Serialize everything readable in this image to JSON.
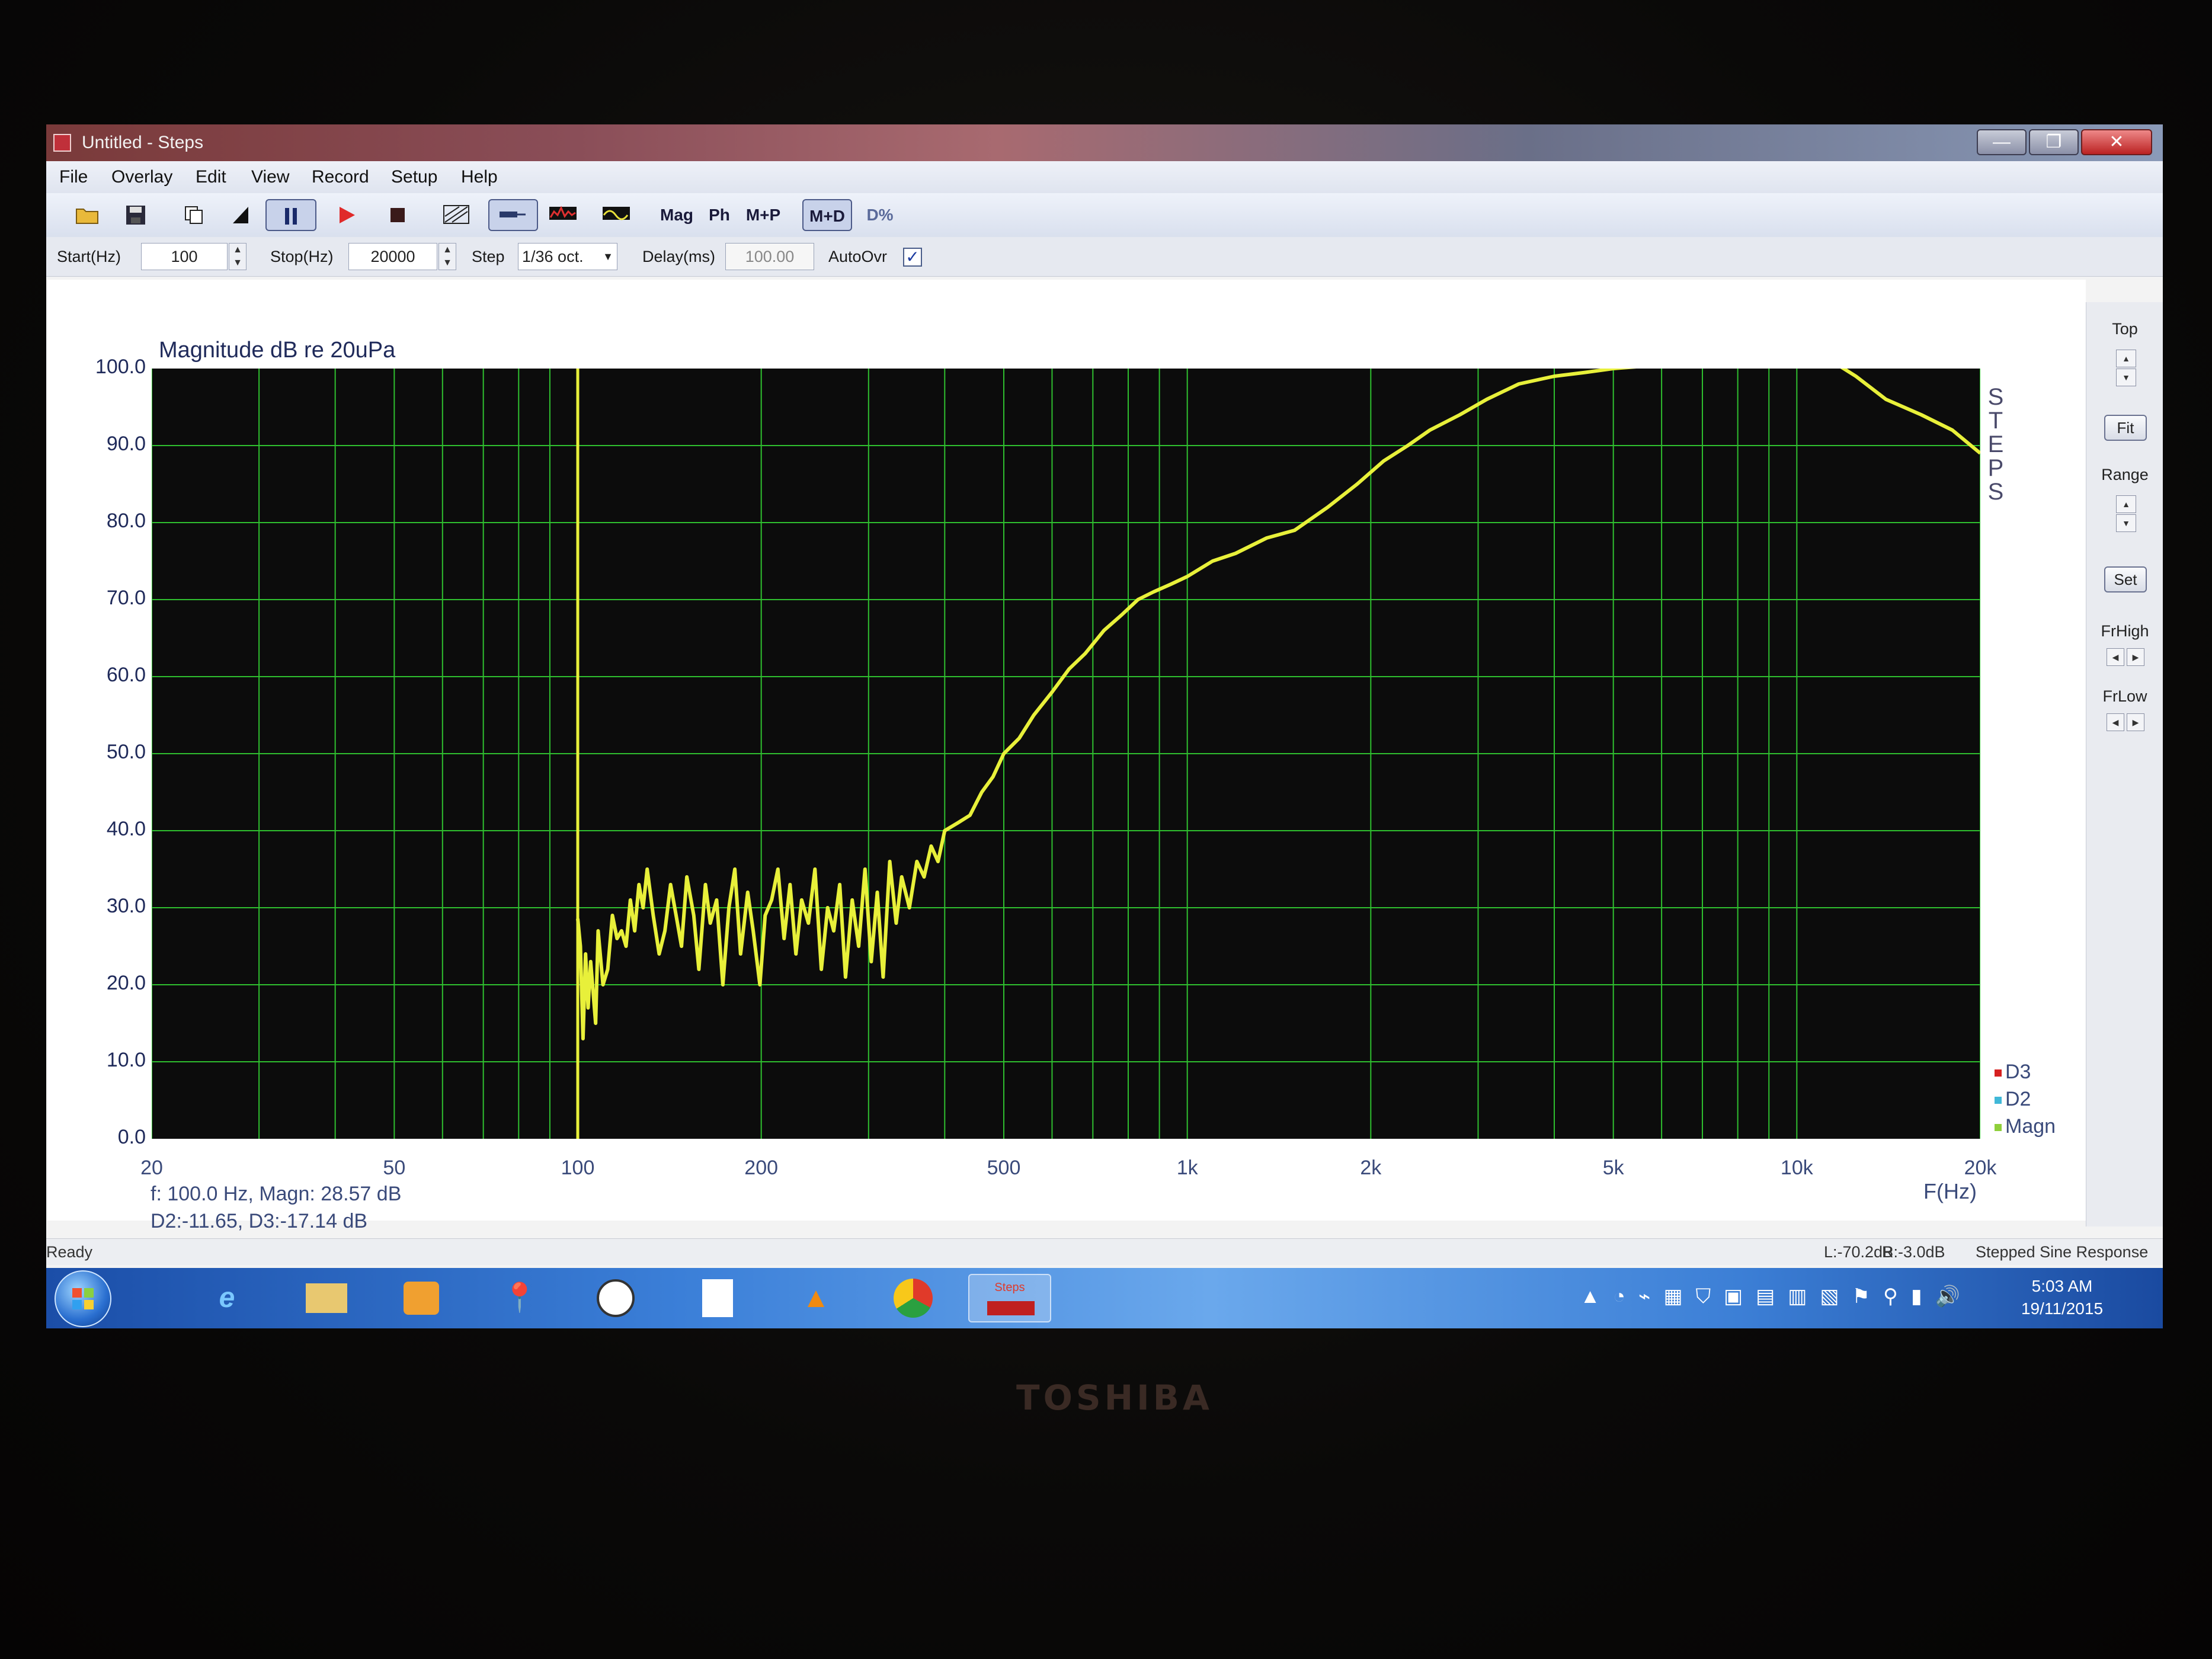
{
  "window": {
    "title": "Untitled - Steps",
    "controls": {
      "minimize": "—",
      "maximize": "❐",
      "close": "✕"
    }
  },
  "menu": [
    "File",
    "Overlay",
    "Edit",
    "View",
    "Record",
    "Setup",
    "Help"
  ],
  "toolbar": {
    "mag": "Mag",
    "ph": "Ph",
    "mp": "M+P",
    "md": "M+D",
    "dpct": "D%"
  },
  "params": {
    "start_label": "Start(Hz)",
    "start_value": "100",
    "stop_label": "Stop(Hz)",
    "stop_value": "20000",
    "step_label": "Step",
    "step_value": "1/36 oct.",
    "delay_label": "Delay(ms)",
    "delay_value": "100.00",
    "autoovr_label": "AutoOvr",
    "autoovr_checked": "✓"
  },
  "right_panel": {
    "top": "Top",
    "fit": "Fit",
    "range": "Range",
    "set": "Set",
    "frhigh": "FrHigh",
    "frlow": "FrLow"
  },
  "readout": {
    "line1": "f:  100.0 Hz, Magn: 28.57 dB",
    "line2": "D2:-11.65, D3:-17.14 dB"
  },
  "status": {
    "left": "Ready",
    "l": "L:-70.2dB",
    "r": "R:-3.0dB",
    "mode": "Stepped Sine Response"
  },
  "taskbar": {
    "time": "5:03 AM",
    "date": "19/11/2015",
    "steps_label": "Steps"
  },
  "brand": "TOSHIBA",
  "chart_data": {
    "type": "line",
    "title": "Magnitude dB re 20uPa",
    "ylabel": "Magnitude dB re 20uPa",
    "xlabel": "F(Hz)",
    "x_scale": "log",
    "xlim": [
      20,
      20000
    ],
    "ylim": [
      0,
      100
    ],
    "yticks": [
      "0.0",
      "10.0",
      "20.0",
      "30.0",
      "40.0",
      "50.0",
      "60.0",
      "70.0",
      "80.0",
      "90.0",
      "100.0"
    ],
    "xticks": [
      {
        "v": 20,
        "label": "20"
      },
      {
        "v": 50,
        "label": "50"
      },
      {
        "v": 100,
        "label": "100"
      },
      {
        "v": 200,
        "label": "200"
      },
      {
        "v": 500,
        "label": "500"
      },
      {
        "v": 1000,
        "label": "1k"
      },
      {
        "v": 2000,
        "label": "2k"
      },
      {
        "v": 5000,
        "label": "5k"
      },
      {
        "v": 10000,
        "label": "10k"
      },
      {
        "v": 20000,
        "label": "20k"
      }
    ],
    "grid": true,
    "side_label": "STEPS",
    "legend": [
      {
        "name": "D3",
        "color": "#d62020"
      },
      {
        "name": "D2",
        "color": "#40b8d8"
      },
      {
        "name": "Magn",
        "color": "#8fcf3a"
      }
    ],
    "cursor_x": 100,
    "colors": {
      "background": "#0c0c0c",
      "grid": "#2fbf2f",
      "trace": "#e8f03a",
      "cursor": "#e8f03a"
    },
    "series": [
      {
        "name": "Magn",
        "x": [
          100,
          101,
          102,
          103,
          104,
          105,
          107,
          108,
          110,
          112,
          114,
          116,
          118,
          120,
          122,
          124,
          126,
          128,
          130,
          133,
          136,
          139,
          142,
          145,
          148,
          151,
          155,
          158,
          162,
          165,
          169,
          173,
          177,
          181,
          185,
          190,
          194,
          199,
          203,
          208,
          213,
          218,
          223,
          228,
          233,
          239,
          245,
          251,
          257,
          263,
          269,
          275,
          282,
          289,
          296,
          303,
          310,
          317,
          325,
          333,
          340,
          350,
          360,
          370,
          380,
          390,
          400,
          420,
          440,
          460,
          480,
          500,
          530,
          560,
          600,
          640,
          680,
          730,
          780,
          830,
          880,
          940,
          1000,
          1100,
          1200,
          1350,
          1500,
          1700,
          1900,
          2100,
          2300,
          2500,
          2800,
          3100,
          3500,
          4000,
          4500,
          5000,
          5600,
          6300,
          7000,
          8000,
          9000,
          10000,
          10700,
          11500,
          12500,
          14000,
          16000,
          18000,
          20000
        ],
        "y": [
          28.57,
          25,
          13,
          24,
          17,
          23,
          15,
          27,
          20,
          22,
          29,
          26,
          27,
          25,
          31,
          27,
          33,
          30,
          35,
          29,
          24,
          27,
          33,
          29,
          25,
          34,
          29,
          22,
          33,
          28,
          31,
          20,
          30,
          35,
          24,
          32,
          27,
          20,
          29,
          31,
          35,
          26,
          33,
          24,
          31,
          28,
          35,
          22,
          30,
          27,
          33,
          21,
          31,
          25,
          35,
          23,
          32,
          21,
          36,
          28,
          34,
          30,
          36,
          34,
          38,
          36,
          40,
          41,
          42,
          45,
          47,
          50,
          52,
          55,
          58,
          61,
          63,
          66,
          68,
          70,
          71,
          72,
          73,
          75,
          76,
          78,
          79,
          82,
          85,
          88,
          90,
          92,
          94,
          96,
          98,
          99,
          99.5,
          100,
          100.3,
          100.5,
          100.7,
          101,
          101.4,
          101.8,
          102.3,
          100.8,
          99,
          96,
          94,
          92,
          89
        ]
      }
    ]
  }
}
